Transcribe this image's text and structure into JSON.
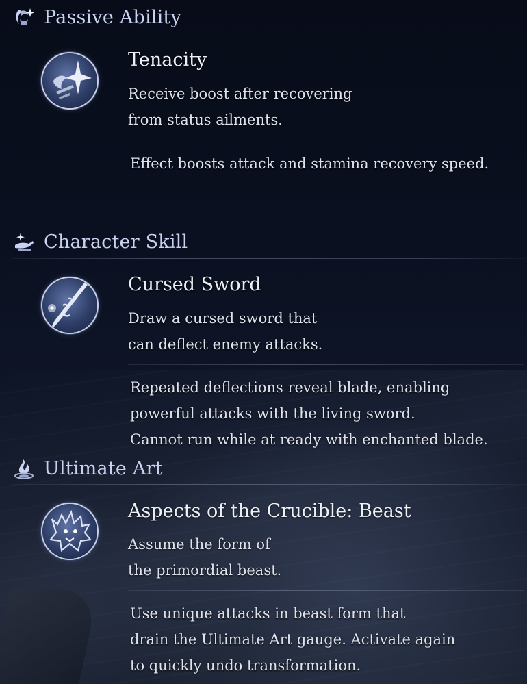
{
  "sections": [
    {
      "header": "Passive Ability",
      "header_icon": "moon-spark-icon",
      "skill": {
        "name": "Tenacity",
        "icon": "tenacity-emblem-icon",
        "desc": [
          "Receive boost after recovering",
          "from status ailments."
        ],
        "detail": [
          "Effect boosts attack and stamina recovery speed."
        ]
      }
    },
    {
      "header": "Character Skill",
      "header_icon": "hand-spark-icon",
      "skill": {
        "name": "Cursed Sword",
        "icon": "cursed-sword-emblem-icon",
        "desc": [
          "Draw a cursed sword that",
          "can deflect enemy attacks."
        ],
        "detail": [
          "Repeated deflections reveal blade, enabling",
          "powerful attacks with the living sword.",
          "Cannot run while at ready with enchanted blade."
        ]
      }
    },
    {
      "header": "Ultimate Art",
      "header_icon": "flame-swirl-icon",
      "skill": {
        "name": "Aspects of the Crucible: Beast",
        "icon": "beast-emblem-icon",
        "desc": [
          "Assume the form of",
          "the primordial beast."
        ],
        "detail": [
          "Use unique attacks in beast form that",
          "drain the Ultimate Art gauge. Activate again",
          "to quickly undo transformation."
        ]
      }
    }
  ],
  "colors": {
    "header": "#c9d2f0",
    "text": "#dfe2ea",
    "background": "#0a1020"
  }
}
